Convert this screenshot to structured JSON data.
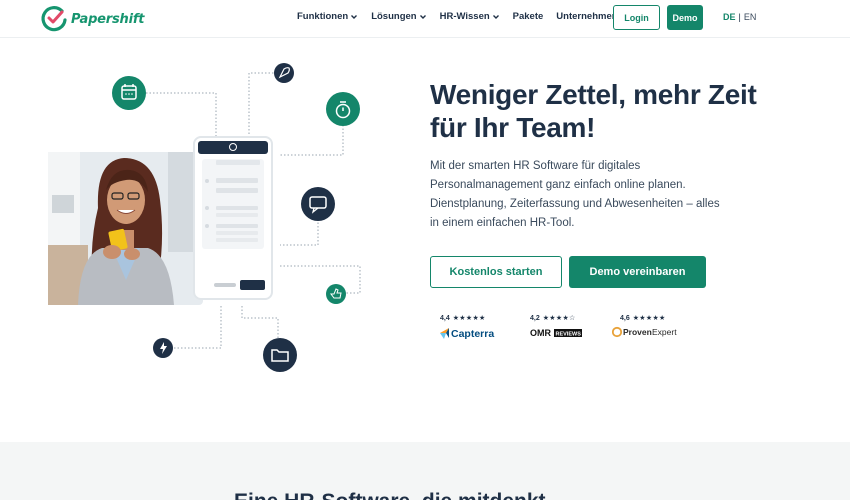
{
  "brand": {
    "name": "Papershift",
    "color": "#14866a",
    "text_color": "#1f3046"
  },
  "nav": {
    "items": [
      {
        "label": "Funktionen",
        "has_dropdown": true
      },
      {
        "label": "Lösungen",
        "has_dropdown": true
      },
      {
        "label": "HR-Wissen",
        "has_dropdown": true
      },
      {
        "label": "Pakete",
        "has_dropdown": false
      },
      {
        "label": "Unternehmen",
        "has_dropdown": true
      }
    ],
    "login_label": "Login",
    "demo_label": "Demo",
    "lang_de": "DE",
    "lang_sep": "|",
    "lang_en": "EN"
  },
  "hero": {
    "title": "Weniger Zettel, mehr Zeit für Ihr Team!",
    "subtitle": "Mit der smarten HR Software für digitales Personalmanagement ganz einfach online planen. Dienstplanung, Zeiterfassung und Abwesenheiten – alles in einem einfachen HR-Tool.",
    "cta_secondary": "Kostenlos starten",
    "cta_primary": "Demo vereinbaren"
  },
  "ratings": [
    {
      "score": "4,4",
      "stars": "★★★★★",
      "platform": "Capterra"
    },
    {
      "score": "4,2",
      "stars": "★★★★☆",
      "platform": "OMR Reviews"
    },
    {
      "score": "4,6",
      "stars": "★★★★★",
      "platform": "Proven Expert"
    }
  ],
  "illustration_icons": [
    "calendar-icon",
    "rocket-icon",
    "stopwatch-icon",
    "chat-icon",
    "thumbs-up-icon",
    "lightning-icon",
    "folder-icon"
  ],
  "next_section": {
    "title": "Eine HR-Software, die mitdenkt"
  }
}
